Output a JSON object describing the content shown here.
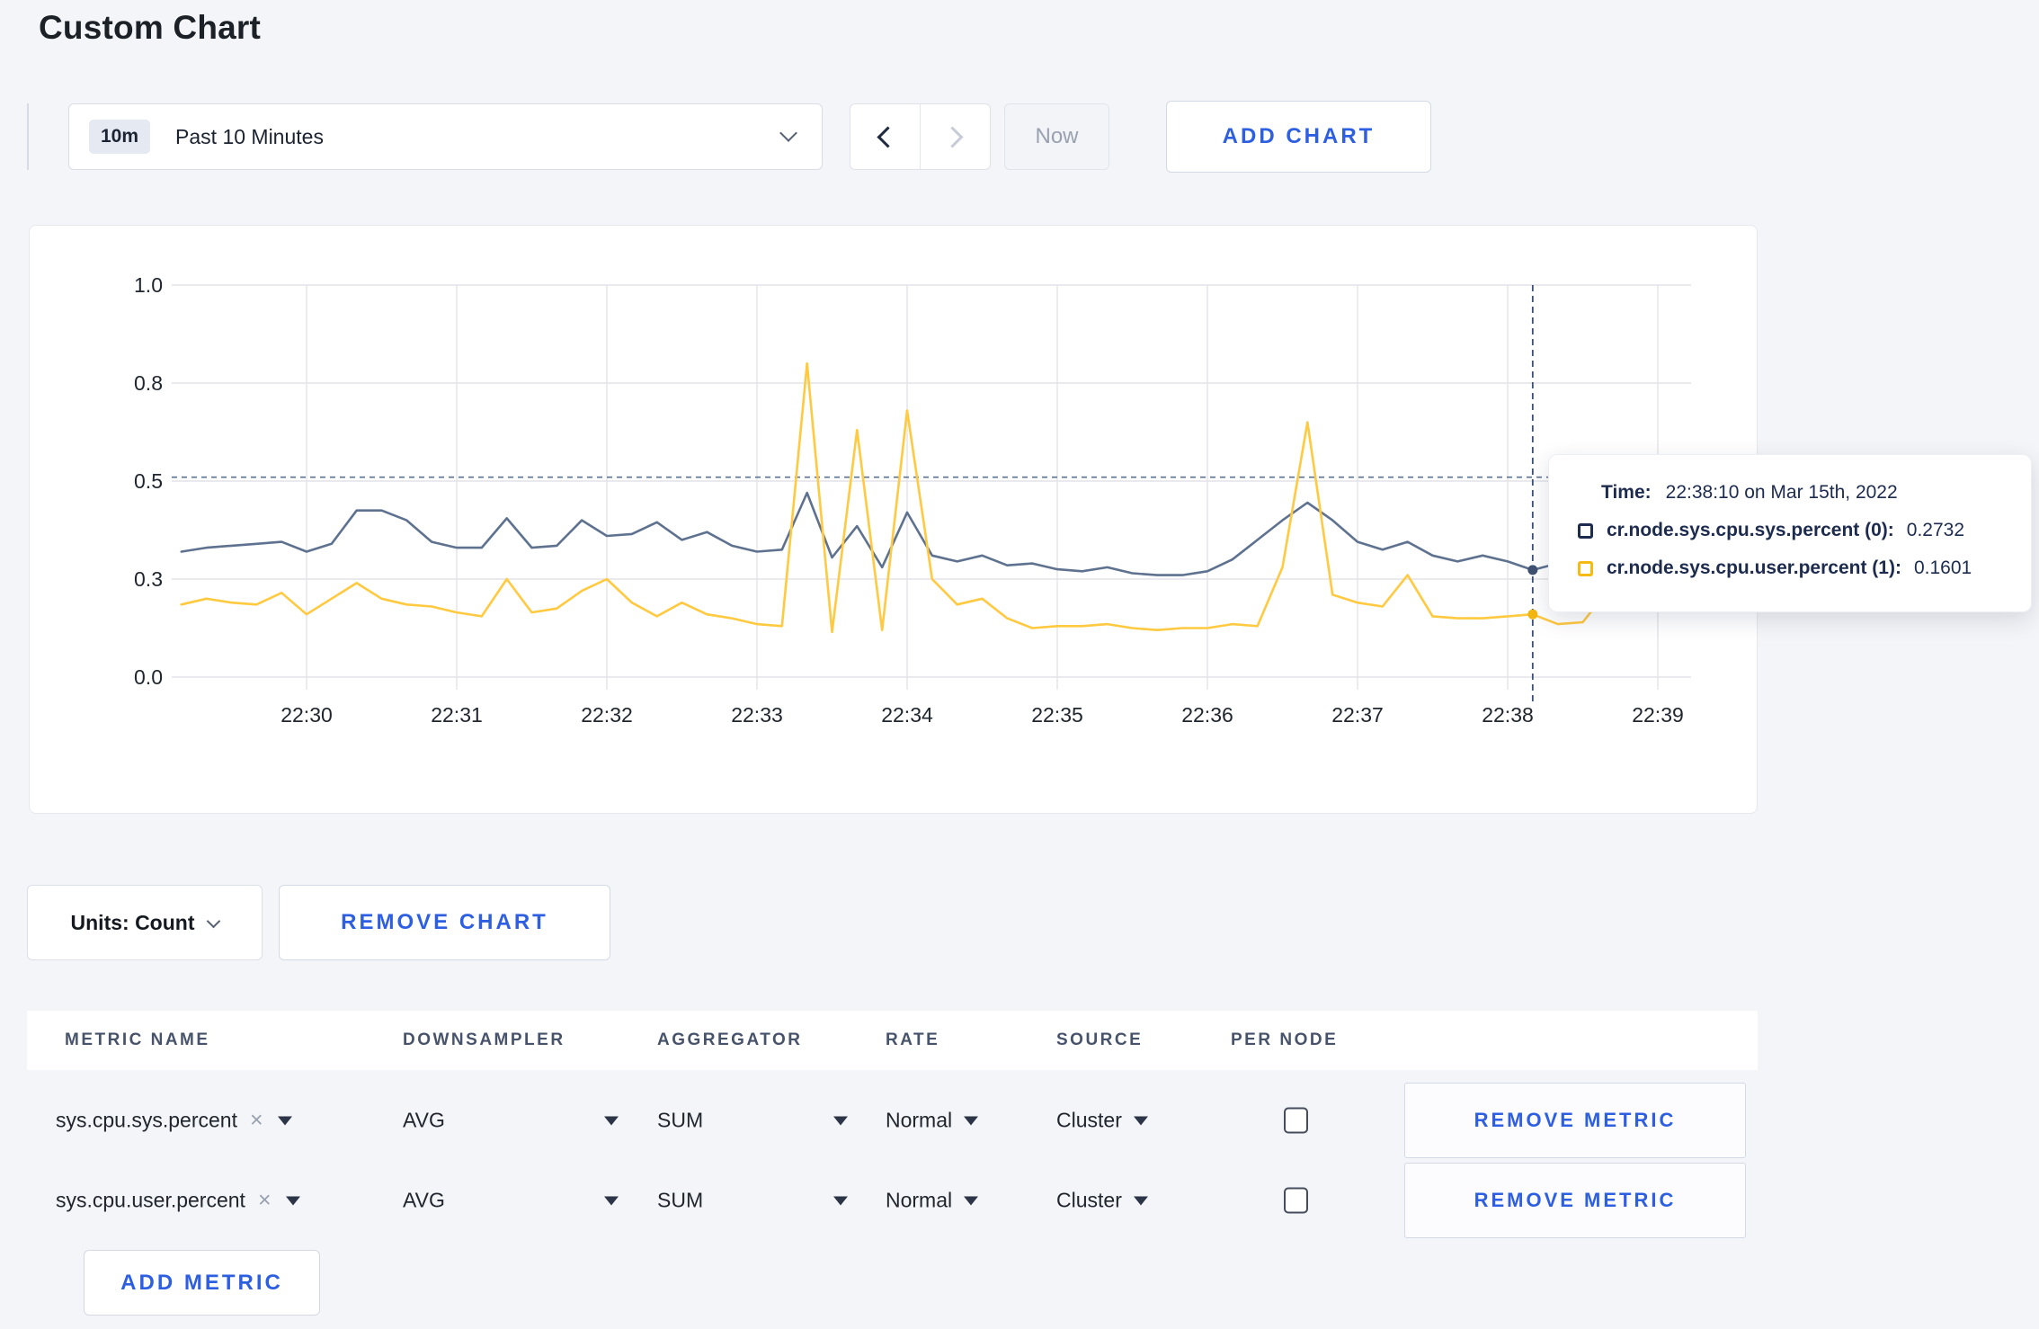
{
  "page": {
    "title": "Custom Chart",
    "background": "#f4f5f8",
    "accent_color": "#2d5fe0"
  },
  "toolbar": {
    "time_window_badge": "10m",
    "time_window_label": "Past 10 Minutes",
    "now_label": "Now",
    "add_chart_label": "ADD CHART"
  },
  "tooltip": {
    "time_label": "Time:",
    "time_value": "22:38:10 on Mar 15th, 2022",
    "series": [
      {
        "label": "cr.node.sys.cpu.sys.percent (0):",
        "value": "0.2732",
        "swatch_color": "#1c2b4e"
      },
      {
        "label": "cr.node.sys.cpu.user.percent (1):",
        "value": "0.1601",
        "swatch_color": "#f5bb13"
      }
    ]
  },
  "chart_controls": {
    "units_label": "Units: Count",
    "remove_chart_label": "REMOVE CHART"
  },
  "metrics_table": {
    "headers": [
      "METRIC NAME",
      "DOWNSAMPLER",
      "AGGREGATOR",
      "RATE",
      "SOURCE",
      "PER NODE"
    ],
    "remove_icon": "×",
    "remove_metric_label": "REMOVE METRIC",
    "add_metric_label": "ADD METRIC",
    "rows": [
      {
        "name": "sys.cpu.sys.percent",
        "downsampler": "AVG",
        "aggregator": "SUM",
        "rate": "Normal",
        "source": "Cluster",
        "per_node_checked": false
      },
      {
        "name": "sys.cpu.user.percent",
        "downsampler": "AVG",
        "aggregator": "SUM",
        "rate": "Normal",
        "source": "Cluster",
        "per_node_checked": false
      }
    ]
  },
  "chart_data": {
    "type": "line",
    "title": "",
    "grid": true,
    "grid_color": "#e3e4e8",
    "label_color": "#20262f",
    "x_axis": {
      "ticks": [
        "22:30",
        "22:31",
        "22:32",
        "22:33",
        "22:34",
        "22:35",
        "22:36",
        "22:37",
        "22:38",
        "22:39"
      ],
      "tick_interval_seconds": 60,
      "start_time": "22:29:10",
      "start_offset_seconds": -50,
      "point_interval_seconds": 10
    },
    "y_axis": {
      "tick_labels": [
        "0.0",
        "0.3",
        "0.5",
        "0.8",
        "1.0"
      ],
      "tick_values": [
        0,
        0.25,
        0.5,
        0.75,
        1
      ],
      "range": [
        0,
        1
      ]
    },
    "series": [
      {
        "name": "cr.node.sys.cpu.sys.percent",
        "color": "#5e7290",
        "values": [
          0.32,
          0.33,
          0.335,
          0.34,
          0.345,
          0.32,
          0.34,
          0.425,
          0.425,
          0.4,
          0.345,
          0.33,
          0.33,
          0.405,
          0.33,
          0.335,
          0.4,
          0.36,
          0.365,
          0.395,
          0.35,
          0.37,
          0.335,
          0.32,
          0.325,
          0.47,
          0.305,
          0.385,
          0.28,
          0.42,
          0.31,
          0.295,
          0.31,
          0.285,
          0.29,
          0.275,
          0.27,
          0.28,
          0.265,
          0.26,
          0.26,
          0.27,
          0.3,
          0.35,
          0.4,
          0.445,
          0.4,
          0.345,
          0.325,
          0.345,
          0.31,
          0.295,
          0.31,
          0.295,
          0.2732,
          0.29,
          0.285,
          0.29,
          0.3,
          0.295,
          0.305
        ]
      },
      {
        "name": "cr.node.sys.cpu.user.percent",
        "color": "#ffc940",
        "values": [
          0.185,
          0.2,
          0.19,
          0.185,
          0.215,
          0.16,
          0.2,
          0.24,
          0.2,
          0.185,
          0.18,
          0.165,
          0.155,
          0.25,
          0.165,
          0.175,
          0.22,
          0.25,
          0.19,
          0.155,
          0.19,
          0.16,
          0.15,
          0.135,
          0.13,
          0.8,
          0.115,
          0.63,
          0.12,
          0.68,
          0.25,
          0.185,
          0.2,
          0.15,
          0.125,
          0.13,
          0.13,
          0.135,
          0.125,
          0.12,
          0.125,
          0.125,
          0.135,
          0.13,
          0.28,
          0.65,
          0.21,
          0.19,
          0.18,
          0.26,
          0.155,
          0.15,
          0.15,
          0.155,
          0.1601,
          0.135,
          0.14,
          0.22,
          0.3,
          0.21,
          0.27
        ]
      }
    ],
    "hover": {
      "time": "22:38:10",
      "offset_seconds": 490,
      "index": 54,
      "crosshair_value": 0.51,
      "crosshair_color": "#3c5073",
      "dot_colors": [
        "#3e5172",
        "#f3b713"
      ],
      "values": [
        0.2732,
        0.1601
      ]
    }
  }
}
